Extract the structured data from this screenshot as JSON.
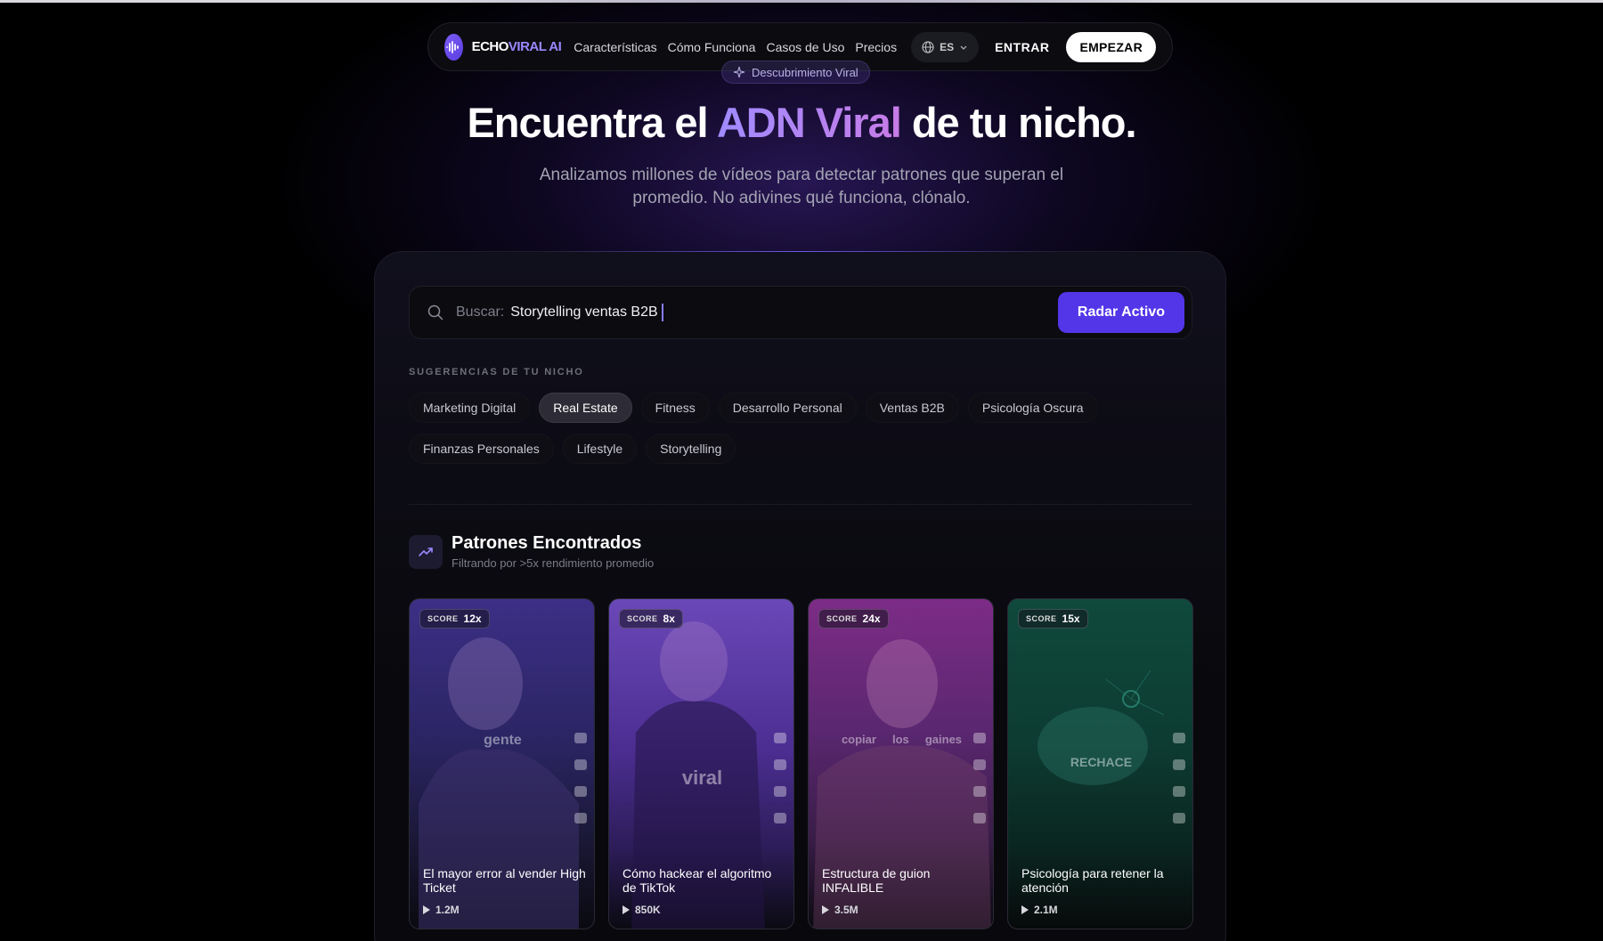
{
  "nav": {
    "logo_part1": "ECHO",
    "logo_part2": "VIRAL AI",
    "links": [
      "Características",
      "Cómo Funciona",
      "Casos de Uso",
      "Precios"
    ],
    "language": "ES",
    "login": "ENTRAR",
    "cta": "EMPEZAR"
  },
  "hero": {
    "badge": "Descubrimiento Viral",
    "title_before": "Encuentra el ",
    "title_highlight": "ADN Viral",
    "title_after": " de tu nicho.",
    "subtitle": "Analizamos millones de vídeos para detectar patrones que superan el promedio. No adivines qué funciona, clónalo."
  },
  "search": {
    "label": "Buscar:",
    "value": "Storytelling ventas B2B",
    "button": "Radar Activo"
  },
  "suggestions": {
    "title": "SUGERENCIAS DE TU NICHO",
    "chips": [
      "Marketing Digital",
      "Real Estate",
      "Fitness",
      "Desarrollo Personal",
      "Ventas B2B",
      "Psicología Oscura",
      "Finanzas Personales",
      "Lifestyle",
      "Storytelling"
    ],
    "active": "Real Estate"
  },
  "results": {
    "title": "Patrones Encontrados",
    "subtitle": "Filtrando por >5x rendimiento promedio",
    "cards": [
      {
        "score_label": "SCORE",
        "score": "12x",
        "overlay": "gente",
        "title": "El mayor error al vender High Ticket",
        "views": "1.2M"
      },
      {
        "score_label": "SCORE",
        "score": "8x",
        "overlay": "viral",
        "title": "Cómo hackear el algoritmo de TikTok",
        "views": "850K"
      },
      {
        "score_label": "SCORE",
        "score": "24x",
        "overlay": "copiar     los     gaines",
        "title": "Estructura de guion INFALIBLE",
        "views": "3.5M"
      },
      {
        "score_label": "SCORE",
        "score": "15x",
        "overlay": "RECHACE",
        "title": "Psicología para retener la atención",
        "views": "2.1M"
      }
    ]
  },
  "colors": {
    "accent": "#5336e8",
    "highlight_gradient_start": "#9f8cff",
    "highlight_gradient_end": "#c77be6"
  }
}
